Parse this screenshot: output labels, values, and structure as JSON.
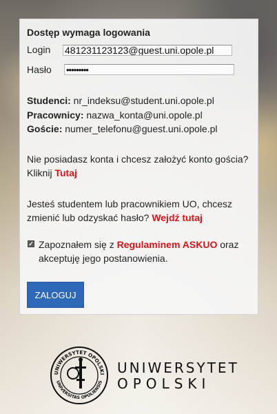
{
  "title": "Dostęp wymaga logowania",
  "login": {
    "label": "Login",
    "value": "481231123123@guest.uni.opole.pl"
  },
  "password": {
    "label": "Hasło",
    "value": "•••••••••"
  },
  "info": {
    "students_label": "Studenci:",
    "students_value": "nr_indeksu@student.uni.opole.pl",
    "staff_label": "Pracownicy:",
    "staff_value": "nazwa_konta@uni.opole.pl",
    "guests_label": "Goście:",
    "guests_value": "numer_telefonu@guest.uni.opole.pl"
  },
  "guest": {
    "text": "Nie posiadasz konta i chcesz założyć konto gościa? Kliknij",
    "link": "Tutaj"
  },
  "change_password": {
    "text": "Jesteś studentem lub pracownikiem UO, chcesz zmienić lub odzyskać hasło?",
    "link": "Wejdź tutaj"
  },
  "consent": {
    "prefix": "Zapoznałem się z",
    "link": "Regulaminem ASKUO",
    "suffix": "oraz akceptuję jego postanowienia.",
    "checked": true
  },
  "submit_label": "ZALOGUJ",
  "logo": {
    "line1": "UNIWERSYTET",
    "line2": "OPOLSKI",
    "seal_top": "UNIWERSYTET OPOLSKI",
    "seal_bottom": "UNIVERSITAS OPOLIENSIS"
  },
  "colors": {
    "accent_link": "#d9141b",
    "button": "#2e68b8"
  }
}
